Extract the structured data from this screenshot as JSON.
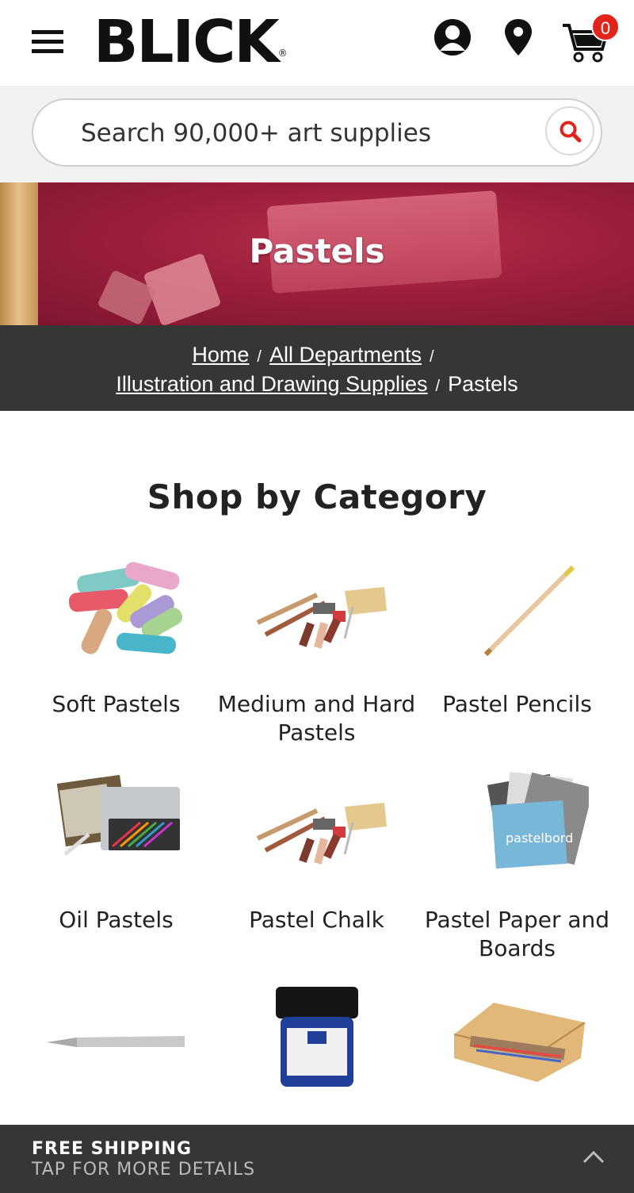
{
  "header": {
    "logo": "BLICK",
    "logo_reg": "®",
    "cart_count": "0",
    "icons": [
      "menu-icon",
      "user-icon",
      "location-pin-icon",
      "cart-icon"
    ]
  },
  "search": {
    "placeholder": "Search 90,000+ art supplies",
    "button_icon": "search-icon"
  },
  "hero": {
    "title": "Pastels"
  },
  "breadcrumb": {
    "items": [
      "Home",
      "All Departments",
      "Illustration and Drawing Supplies",
      "Pastels"
    ],
    "separator": "/"
  },
  "category": {
    "heading": "Shop by Category",
    "items": [
      {
        "label": "Soft Pastels"
      },
      {
        "label": "Medium and Hard Pastels"
      },
      {
        "label": "Pastel Pencils"
      },
      {
        "label": "Oil Pastels"
      },
      {
        "label": "Pastel Chalk"
      },
      {
        "label": "Pastel Paper and Boards"
      },
      {
        "label": ""
      },
      {
        "label": ""
      },
      {
        "label": ""
      }
    ]
  },
  "shipping_bar": {
    "title": "FREE SHIPPING",
    "subtitle": "TAP FOR MORE DETAILS"
  },
  "colors": {
    "accent_red": "#e4231b",
    "dark_bar": "#363636",
    "hero_bg": "#9b1f3b"
  }
}
